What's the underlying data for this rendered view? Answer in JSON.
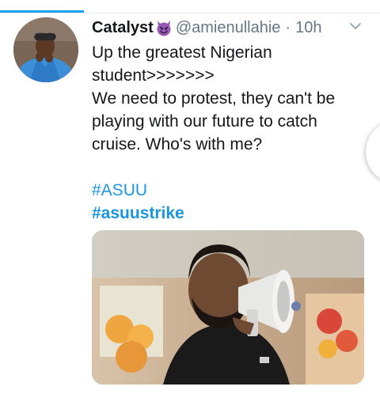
{
  "tweet": {
    "display_name": "Catalyst",
    "name_emoji": "smiling-devil-icon",
    "handle": "@amienullahie",
    "separator": "·",
    "time": "10h",
    "text_line_1": "Up the greatest Nigerian",
    "text_line_2": "student>>>>>>>",
    "text_line_3": "We need to protest, they can't be",
    "text_line_4": "playing with our future to catch",
    "text_line_5": "cruise. Who's with me?",
    "hashtags": [
      "#ASUU",
      "#asuustrike"
    ],
    "media_description_icon": "megaphone-photo"
  },
  "colors": {
    "accent": "#1da1f2",
    "link": "#1b95e0",
    "text": "#14171a",
    "muted": "#657786"
  }
}
